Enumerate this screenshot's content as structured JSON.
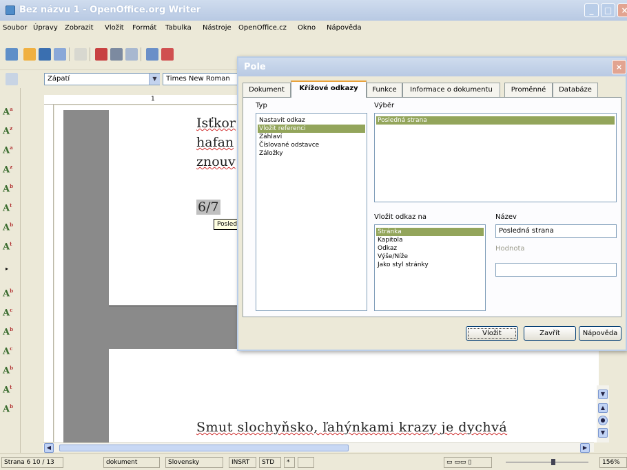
{
  "window": {
    "title": "Bez názvu 1 - OpenOffice.org Writer"
  },
  "menu": [
    "Soubor",
    "Úpravy",
    "Zobrazit",
    "Vložit",
    "Formát",
    "Tabulka",
    "Nástroje",
    "OpenOffice.cz",
    "Okno",
    "Nápověda"
  ],
  "formatting": {
    "style": "Zápatí",
    "font": "Times New Roman"
  },
  "document": {
    "lines_top": [
      "Isťkor",
      "hafan",
      "znouv"
    ],
    "field_value": "6/7",
    "tooltip": "Posledná strana",
    "bottom_line": "Smut slochyňsko, ľahýnkami krazy je dychvá"
  },
  "ruler_mark": "1",
  "dialog": {
    "title": "Pole",
    "tabs": [
      "Dokument",
      "Křížové odkazy",
      "Funkce",
      "Informace o dokumentu",
      "Proměnné",
      "Databáze"
    ],
    "type_label": "Typ",
    "type_items": [
      "Nastavit odkaz",
      "Vložit referenci",
      "Záhlaví",
      "Číslované odstavce",
      "Záložky"
    ],
    "selection_label": "Výběr",
    "selection_items": [
      "Posledná strana"
    ],
    "insert_ref_label": "Vložit odkaz na",
    "insert_ref_items": [
      "Stránka",
      "Kapitola",
      "Odkaz",
      "Výše/Níže",
      "Jako styl stránky"
    ],
    "name_label": "Název",
    "name_value": "Posledná strana",
    "value_label": "Hodnota",
    "value_value": "",
    "buttons": {
      "insert": "Vložit",
      "close": "Zavřít",
      "help": "Nápověda"
    }
  },
  "status": {
    "page": "Strana 6  10 / 13",
    "style": "dokument",
    "language": "Slovensky",
    "insert": "INSRT",
    "selmode": "STD",
    "modified": "*",
    "zoom": "156%"
  }
}
